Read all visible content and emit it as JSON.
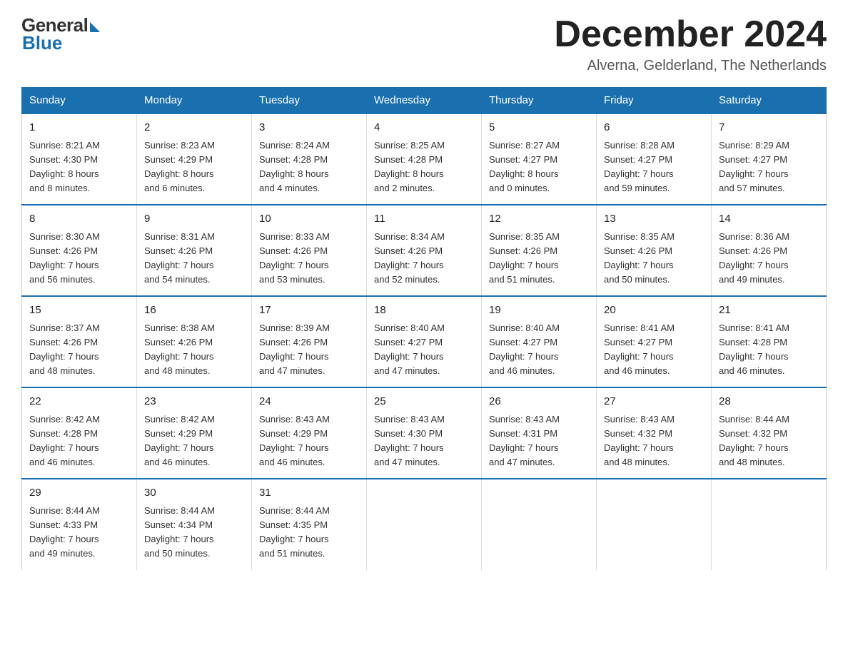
{
  "logo": {
    "general": "General",
    "blue": "Blue",
    "tagline": "Blue"
  },
  "header": {
    "month": "December 2024",
    "location": "Alverna, Gelderland, The Netherlands"
  },
  "weekdays": [
    "Sunday",
    "Monday",
    "Tuesday",
    "Wednesday",
    "Thursday",
    "Friday",
    "Saturday"
  ],
  "weeks": [
    [
      {
        "day": "1",
        "info": "Sunrise: 8:21 AM\nSunset: 4:30 PM\nDaylight: 8 hours\nand 8 minutes."
      },
      {
        "day": "2",
        "info": "Sunrise: 8:23 AM\nSunset: 4:29 PM\nDaylight: 8 hours\nand 6 minutes."
      },
      {
        "day": "3",
        "info": "Sunrise: 8:24 AM\nSunset: 4:28 PM\nDaylight: 8 hours\nand 4 minutes."
      },
      {
        "day": "4",
        "info": "Sunrise: 8:25 AM\nSunset: 4:28 PM\nDaylight: 8 hours\nand 2 minutes."
      },
      {
        "day": "5",
        "info": "Sunrise: 8:27 AM\nSunset: 4:27 PM\nDaylight: 8 hours\nand 0 minutes."
      },
      {
        "day": "6",
        "info": "Sunrise: 8:28 AM\nSunset: 4:27 PM\nDaylight: 7 hours\nand 59 minutes."
      },
      {
        "day": "7",
        "info": "Sunrise: 8:29 AM\nSunset: 4:27 PM\nDaylight: 7 hours\nand 57 minutes."
      }
    ],
    [
      {
        "day": "8",
        "info": "Sunrise: 8:30 AM\nSunset: 4:26 PM\nDaylight: 7 hours\nand 56 minutes."
      },
      {
        "day": "9",
        "info": "Sunrise: 8:31 AM\nSunset: 4:26 PM\nDaylight: 7 hours\nand 54 minutes."
      },
      {
        "day": "10",
        "info": "Sunrise: 8:33 AM\nSunset: 4:26 PM\nDaylight: 7 hours\nand 53 minutes."
      },
      {
        "day": "11",
        "info": "Sunrise: 8:34 AM\nSunset: 4:26 PM\nDaylight: 7 hours\nand 52 minutes."
      },
      {
        "day": "12",
        "info": "Sunrise: 8:35 AM\nSunset: 4:26 PM\nDaylight: 7 hours\nand 51 minutes."
      },
      {
        "day": "13",
        "info": "Sunrise: 8:35 AM\nSunset: 4:26 PM\nDaylight: 7 hours\nand 50 minutes."
      },
      {
        "day": "14",
        "info": "Sunrise: 8:36 AM\nSunset: 4:26 PM\nDaylight: 7 hours\nand 49 minutes."
      }
    ],
    [
      {
        "day": "15",
        "info": "Sunrise: 8:37 AM\nSunset: 4:26 PM\nDaylight: 7 hours\nand 48 minutes."
      },
      {
        "day": "16",
        "info": "Sunrise: 8:38 AM\nSunset: 4:26 PM\nDaylight: 7 hours\nand 48 minutes."
      },
      {
        "day": "17",
        "info": "Sunrise: 8:39 AM\nSunset: 4:26 PM\nDaylight: 7 hours\nand 47 minutes."
      },
      {
        "day": "18",
        "info": "Sunrise: 8:40 AM\nSunset: 4:27 PM\nDaylight: 7 hours\nand 47 minutes."
      },
      {
        "day": "19",
        "info": "Sunrise: 8:40 AM\nSunset: 4:27 PM\nDaylight: 7 hours\nand 46 minutes."
      },
      {
        "day": "20",
        "info": "Sunrise: 8:41 AM\nSunset: 4:27 PM\nDaylight: 7 hours\nand 46 minutes."
      },
      {
        "day": "21",
        "info": "Sunrise: 8:41 AM\nSunset: 4:28 PM\nDaylight: 7 hours\nand 46 minutes."
      }
    ],
    [
      {
        "day": "22",
        "info": "Sunrise: 8:42 AM\nSunset: 4:28 PM\nDaylight: 7 hours\nand 46 minutes."
      },
      {
        "day": "23",
        "info": "Sunrise: 8:42 AM\nSunset: 4:29 PM\nDaylight: 7 hours\nand 46 minutes."
      },
      {
        "day": "24",
        "info": "Sunrise: 8:43 AM\nSunset: 4:29 PM\nDaylight: 7 hours\nand 46 minutes."
      },
      {
        "day": "25",
        "info": "Sunrise: 8:43 AM\nSunset: 4:30 PM\nDaylight: 7 hours\nand 47 minutes."
      },
      {
        "day": "26",
        "info": "Sunrise: 8:43 AM\nSunset: 4:31 PM\nDaylight: 7 hours\nand 47 minutes."
      },
      {
        "day": "27",
        "info": "Sunrise: 8:43 AM\nSunset: 4:32 PM\nDaylight: 7 hours\nand 48 minutes."
      },
      {
        "day": "28",
        "info": "Sunrise: 8:44 AM\nSunset: 4:32 PM\nDaylight: 7 hours\nand 48 minutes."
      }
    ],
    [
      {
        "day": "29",
        "info": "Sunrise: 8:44 AM\nSunset: 4:33 PM\nDaylight: 7 hours\nand 49 minutes."
      },
      {
        "day": "30",
        "info": "Sunrise: 8:44 AM\nSunset: 4:34 PM\nDaylight: 7 hours\nand 50 minutes."
      },
      {
        "day": "31",
        "info": "Sunrise: 8:44 AM\nSunset: 4:35 PM\nDaylight: 7 hours\nand 51 minutes."
      },
      {
        "day": "",
        "info": ""
      },
      {
        "day": "",
        "info": ""
      },
      {
        "day": "",
        "info": ""
      },
      {
        "day": "",
        "info": ""
      }
    ]
  ]
}
